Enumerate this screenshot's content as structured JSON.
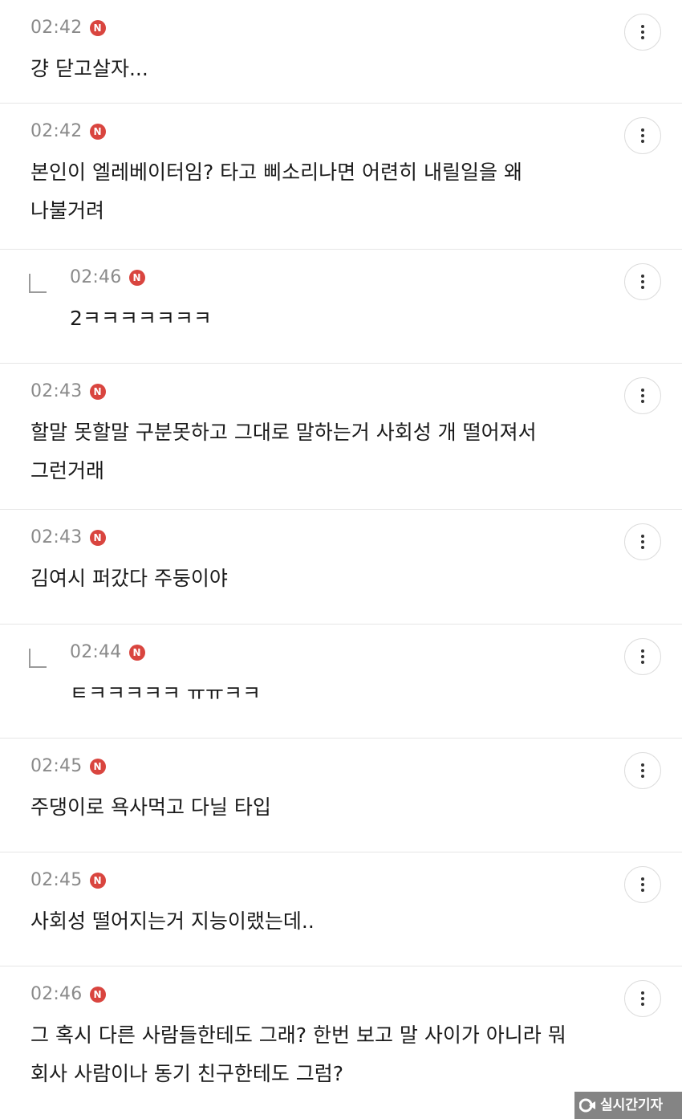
{
  "badge_new": "N",
  "comments": [
    {
      "time": "02:42",
      "text": "걍 닫고살자...",
      "reply": false
    },
    {
      "time": "02:42",
      "text": "본인이 엘레베이터임? 타고 삐소리나면 어련히 내릴일을 왜\n나불거려",
      "reply": false
    },
    {
      "time": "02:46",
      "text": "2ㅋㅋㅋㅋㅋㅋㅋ",
      "reply": true
    },
    {
      "time": "02:43",
      "text": "할말 못할말 구분못하고 그대로 말하는거 사회성 개 떨어져서\n그런거래",
      "reply": false
    },
    {
      "time": "02:43",
      "text": "김여시 퍼갔다 주둥이야",
      "reply": false
    },
    {
      "time": "02:44",
      "text": "ㅌㅋㅋㅋㅋㅋ ㅠㅠㅋㅋ",
      "reply": true
    },
    {
      "time": "02:45",
      "text": "주댕이로 욕사먹고 다닐 타입",
      "reply": false
    },
    {
      "time": "02:45",
      "text": "사회성 떨어지는거 지능이랬는데..",
      "reply": false
    },
    {
      "time": "02:46",
      "text": "그 혹시 다른 사람들한테도 그래? 한번 보고 말 사이가 아니라 뭐\n회사 사람이나 동기 친구한테도 그럼?",
      "reply": false
    }
  ],
  "more_icon": "more-vertical-icon",
  "watermark": {
    "logo": "logo-icon",
    "text": "실시간기자"
  },
  "colors": {
    "badge": "#d9453f",
    "time": "#8a8a8a",
    "divider": "#e6e6e6"
  }
}
